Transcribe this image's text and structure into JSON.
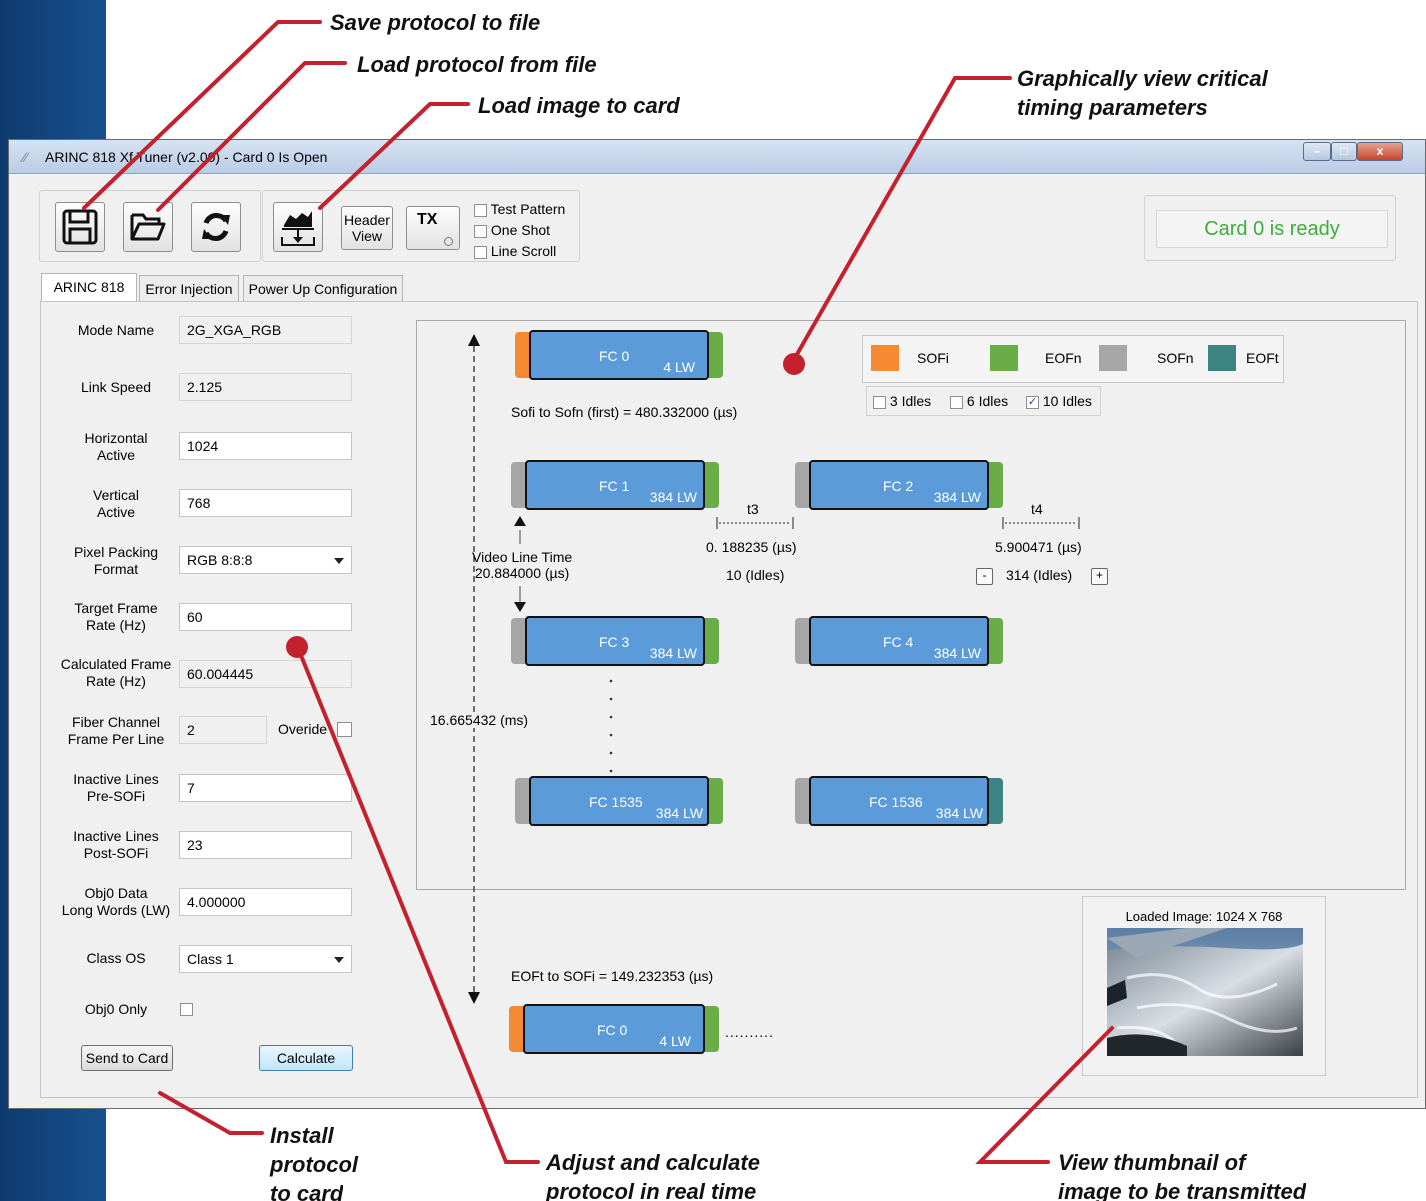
{
  "callouts": {
    "save": "Save protocol to file",
    "load": "Load protocol from file",
    "image": "Load image to card",
    "graph_line1": "Graphically view critical",
    "graph_line2": "timing parameters",
    "install_1": "Install",
    "install_2": "protocol",
    "install_3": "to card",
    "adjust_1": "Adjust and calculate",
    "adjust_2": "protocol in real time",
    "thumb_1": "View thumbnail of",
    "thumb_2": "image to be transmitted"
  },
  "window": {
    "title": "ARINC 818 Xf Tuner (v2.00) - Card 0 Is Open",
    "minimize": "–",
    "maximize": "□",
    "close": "x"
  },
  "toolbar": {
    "header_view_1": "Header",
    "header_view_2": "View",
    "tx": "TX",
    "checks": [
      {
        "label": "Test Pattern",
        "checked": false
      },
      {
        "label": "One Shot",
        "checked": false
      },
      {
        "label": "Line Scroll",
        "checked": false
      }
    ],
    "status": "Card 0 is ready",
    "status_color": "#3dae3b"
  },
  "tabs": [
    "ARINC 818",
    "Error Injection",
    "Power Up Configuration"
  ],
  "form": {
    "mode_name_label": "Mode Name",
    "mode_name": "2G_XGA_RGB",
    "link_speed_label": "Link Speed",
    "link_speed": "2.125",
    "h_active_1": "Horizontal",
    "h_active_2": "Active",
    "h_active": "1024",
    "v_active_1": "Vertical",
    "v_active_2": "Active",
    "v_active": "768",
    "pixel_1": "Pixel Packing",
    "pixel_2": "Format",
    "pixel": "RGB 8:8:8",
    "target_1": "Target Frame",
    "target_2": "Rate (Hz)",
    "target": "60",
    "calc_1": "Calculated Frame",
    "calc_2": "Rate (Hz)",
    "calc": "60.004445",
    "fc_1": "Fiber Channel",
    "fc_2": "Frame Per Line",
    "fc": "2",
    "override": "Overide",
    "inpre_1": "Inactive Lines",
    "inpre_2": "Pre-SOFi",
    "inpre": "7",
    "inpost_1": "Inactive Lines",
    "inpost_2": "Post-SOFi",
    "inpost": "23",
    "obj_1": "Obj0 Data",
    "obj_2": "Long Words (LW)",
    "obj": "4.000000",
    "class_label": "Class OS",
    "class": "Class 1",
    "obj_only": "Obj0 Only",
    "send": "Send to Card",
    "calculate": "Calculate"
  },
  "diagram": {
    "legend": [
      {
        "label": "SOFi",
        "color": "#f58a33"
      },
      {
        "label": "EOFn",
        "color": "#6aac46"
      },
      {
        "label": "SOFn",
        "color": "#a6a6a6"
      },
      {
        "label": "EOFt",
        "color": "#3b8482"
      }
    ],
    "idles": [
      {
        "label": "3 Idles",
        "checked": false
      },
      {
        "label": "6 Idles",
        "checked": false
      },
      {
        "label": "10 Idles",
        "checked": true
      }
    ],
    "frames": [
      {
        "name": "FC 0",
        "lw": "4 LW"
      },
      {
        "name": "FC 1",
        "lw": "384 LW"
      },
      {
        "name": "FC 2",
        "lw": "384 LW"
      },
      {
        "name": "FC 3",
        "lw": "384 LW"
      },
      {
        "name": "FC 4",
        "lw": "384 LW"
      },
      {
        "name": "FC 1535",
        "lw": "384 LW"
      },
      {
        "name": "FC 1536",
        "lw": "384 LW"
      },
      {
        "name": "FC 0",
        "lw": "4 LW"
      }
    ],
    "sofi_to_sofn": "Sofi to Sofn (first) =  480.332000 (µs)",
    "t3": "t3",
    "t4": "t4",
    "t3_val": "0. 188235 (µs)",
    "t4_val": "5.900471 (µs)",
    "t3_idles": "10 (Idles)",
    "t4_idles": "314 (Idles)",
    "minus": "-",
    "plus": "+",
    "video_line_1": "Video Line Time",
    "video_line_2": "20.884000 (µs)",
    "total": "16.665432 (ms)",
    "eoft_to_sofi": "EOFt to SOFi =  149.232353 (µs)",
    "trailing": "..........",
    "loaded_image": "Loaded Image: 1024 X 768"
  }
}
